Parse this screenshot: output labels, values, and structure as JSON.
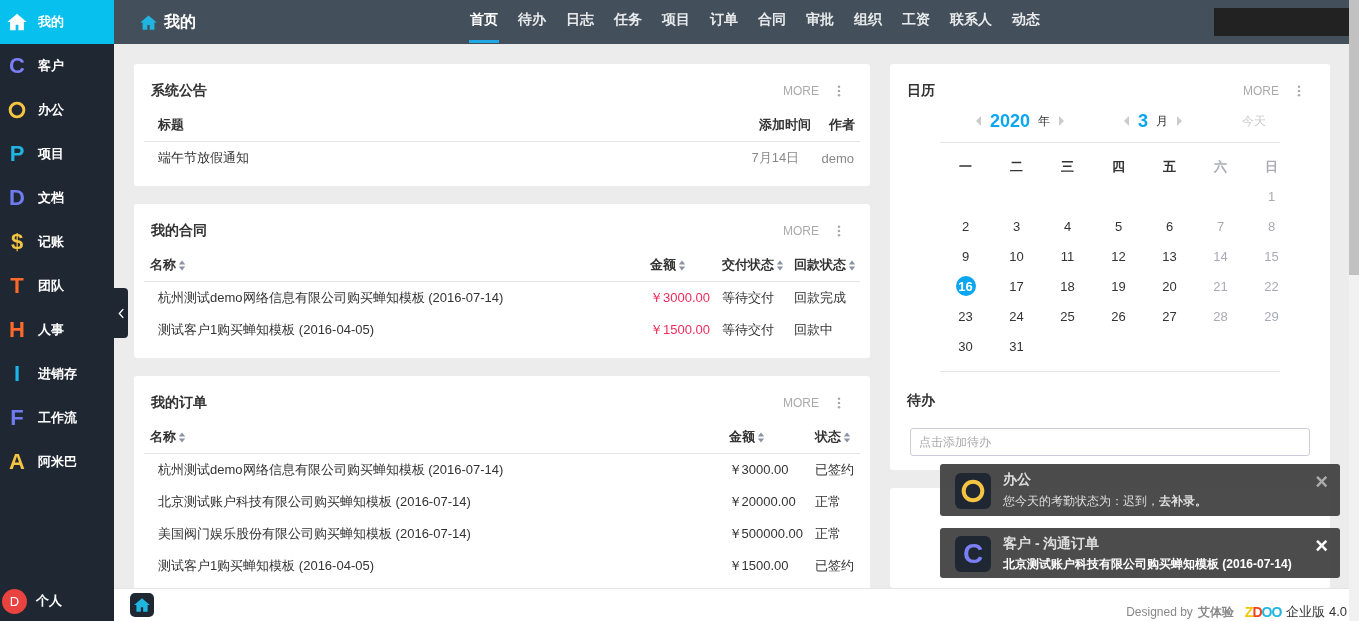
{
  "sidebar": {
    "items": [
      {
        "label": "我的",
        "color": "#ffffff",
        "selected": true,
        "kind": "home"
      },
      {
        "letter": "C",
        "label": "客户",
        "color": "#7b7ff5",
        "selected": false,
        "kind": "letter"
      },
      {
        "label": "办公",
        "color": "#f5c542",
        "selected": false,
        "kind": "ring"
      },
      {
        "letter": "P",
        "label": "项目",
        "color": "#1fb5e0",
        "selected": false,
        "kind": "letter"
      },
      {
        "letter": "D",
        "label": "文档",
        "color": "#6f7cf0",
        "selected": false,
        "kind": "letter"
      },
      {
        "letter": "$",
        "label": "记账",
        "color": "#f5c542",
        "selected": false,
        "kind": "letter"
      },
      {
        "letter": "T",
        "label": "团队",
        "color": "#ff6a2a",
        "selected": false,
        "kind": "letter"
      },
      {
        "letter": "H",
        "label": "人事",
        "color": "#ff6a2a",
        "selected": false,
        "kind": "letter"
      },
      {
        "letter": "I",
        "label": "进销存",
        "color": "#19b7e8",
        "selected": false,
        "kind": "letter"
      },
      {
        "letter": "F",
        "label": "工作流",
        "color": "#6f7cf0",
        "selected": false,
        "kind": "letter"
      },
      {
        "letter": "A",
        "label": "阿米巴",
        "color": "#f5c542",
        "selected": false,
        "kind": "letter"
      }
    ],
    "user": {
      "initial": "D",
      "label": "个人"
    }
  },
  "topbar": {
    "title": "我的",
    "tabs": [
      {
        "label": "首页",
        "selected": true
      },
      {
        "label": "待办",
        "selected": false
      },
      {
        "label": "日志",
        "selected": false
      },
      {
        "label": "任务",
        "selected": false
      },
      {
        "label": "项目",
        "selected": false
      },
      {
        "label": "订单",
        "selected": false
      },
      {
        "label": "合同",
        "selected": false
      },
      {
        "label": "审批",
        "selected": false
      },
      {
        "label": "组织",
        "selected": false
      },
      {
        "label": "工资",
        "selected": false
      },
      {
        "label": "联系人",
        "selected": false
      },
      {
        "label": "动态",
        "selected": false
      }
    ]
  },
  "panels": [
    {
      "title": "系统公告",
      "more": "MORE",
      "columns": [
        {
          "label": "标题",
          "sortable": false,
          "emphasis": false
        },
        {
          "label": "添加时间",
          "sortable": false,
          "emphasis": false
        },
        {
          "label": "作者",
          "sortable": false,
          "emphasis": false
        }
      ],
      "rows": [
        [
          "端午节放假通知",
          "7月14日",
          "demo"
        ]
      ]
    },
    {
      "title": "我的合同",
      "more": "MORE",
      "columns": [
        {
          "label": "名称",
          "sortable": true,
          "emphasis": false
        },
        {
          "label": "金额",
          "sortable": true,
          "emphasis": true
        },
        {
          "label": "交付状态",
          "sortable": true,
          "emphasis": false
        },
        {
          "label": "回款状态",
          "sortable": true,
          "emphasis": false
        }
      ],
      "rows": [
        [
          "杭州测试demo网络信息有限公司购买蝉知模板 (2016-07-14)",
          "￥3000.00",
          "等待交付",
          "回款完成"
        ],
        [
          "测试客户1购买蝉知模板 (2016-04-05)",
          "￥1500.00",
          "等待交付",
          "回款中"
        ]
      ]
    },
    {
      "title": "我的订单",
      "more": "MORE",
      "columns": [
        {
          "label": "名称",
          "sortable": true,
          "emphasis": false
        },
        {
          "label": "金额",
          "sortable": true,
          "emphasis": false
        },
        {
          "label": "状态",
          "sortable": true,
          "emphasis": false
        }
      ],
      "rows": [
        [
          "杭州测试demo网络信息有限公司购买蝉知模板 (2016-07-14)",
          "￥3000.00",
          "已签约"
        ],
        [
          "北京测试账户科技有限公司购买蝉知模板 (2016-07-14)",
          "￥20000.00",
          "正常"
        ],
        [
          "美国阀门娱乐股份有限公司购买蝉知模板 (2016-07-14)",
          "￥500000.00",
          "正常"
        ],
        [
          "测试客户1购买蝉知模板 (2016-04-05)",
          "￥1500.00",
          "已签约"
        ]
      ]
    }
  ],
  "calendar": {
    "title": "日历",
    "more": "MORE",
    "year": "2020",
    "year_unit": "年",
    "month": "3",
    "month_unit": "月",
    "today": "今天",
    "weekdays": [
      {
        "label": "一",
        "weekend": false
      },
      {
        "label": "二",
        "weekend": false
      },
      {
        "label": "三",
        "weekend": false
      },
      {
        "label": "四",
        "weekend": false
      },
      {
        "label": "五",
        "weekend": false
      },
      {
        "label": "六",
        "weekend": true
      },
      {
        "label": "日",
        "weekend": true
      }
    ],
    "weeks": [
      [
        {
          "label": "1",
          "weekend": true,
          "selected": false
        }
      ],
      [
        {
          "label": "2",
          "weekend": false,
          "selected": false
        },
        {
          "label": "3",
          "weekend": false,
          "selected": false
        },
        {
          "label": "4",
          "weekend": false,
          "selected": false
        },
        {
          "label": "5",
          "weekend": false,
          "selected": false
        },
        {
          "label": "6",
          "weekend": false,
          "selected": false
        },
        {
          "label": "7",
          "weekend": true,
          "selected": false
        },
        {
          "label": "8",
          "weekend": true,
          "selected": false
        }
      ],
      [
        {
          "label": "9",
          "weekend": false,
          "selected": false
        },
        {
          "label": "10",
          "weekend": false,
          "selected": false
        },
        {
          "label": "11",
          "weekend": false,
          "selected": false
        },
        {
          "label": "12",
          "weekend": false,
          "selected": false
        },
        {
          "label": "13",
          "weekend": false,
          "selected": false
        },
        {
          "label": "14",
          "weekend": true,
          "selected": false
        },
        {
          "label": "15",
          "weekend": true,
          "selected": false
        }
      ],
      [
        {
          "label": "16",
          "weekend": false,
          "selected": true
        },
        {
          "label": "17",
          "weekend": false,
          "selected": false
        },
        {
          "label": "18",
          "weekend": false,
          "selected": false
        },
        {
          "label": "19",
          "weekend": false,
          "selected": false
        },
        {
          "label": "20",
          "weekend": false,
          "selected": false
        },
        {
          "label": "21",
          "weekend": true,
          "selected": false
        },
        {
          "label": "22",
          "weekend": true,
          "selected": false
        }
      ],
      [
        {
          "label": "23",
          "weekend": false,
          "selected": false
        },
        {
          "label": "24",
          "weekend": false,
          "selected": false
        },
        {
          "label": "25",
          "weekend": false,
          "selected": false
        },
        {
          "label": "26",
          "weekend": false,
          "selected": false
        },
        {
          "label": "27",
          "weekend": false,
          "selected": false
        },
        {
          "label": "28",
          "weekend": true,
          "selected": false
        },
        {
          "label": "29",
          "weekend": true,
          "selected": false
        }
      ],
      [
        {
          "label": "30",
          "weekend": false,
          "selected": false
        },
        {
          "label": "31",
          "weekend": false,
          "selected": false
        }
      ]
    ],
    "todo_title": "待办",
    "todo_placeholder": "点击添加待办"
  },
  "notifications": [
    {
      "kind": "ring",
      "color": "#f5c542",
      "title": "办公",
      "message": "您今天的考勤状态为：迟到，**去补录。**",
      "message_bold": false,
      "close": "×",
      "active": false
    },
    {
      "kind": "letter",
      "letter": "C",
      "color": "#7b7ff5",
      "title": "客户 - 沟通订单",
      "message": "北京测试账户科技有限公司购买蝉知模板 (2016-07-14)",
      "message_bold": true,
      "close": "×",
      "active": true
    }
  ],
  "footer": {
    "designed_by": "Designed by",
    "designer": "艾体验",
    "logo": "ZDOO",
    "edition": "企业版 4.0"
  }
}
